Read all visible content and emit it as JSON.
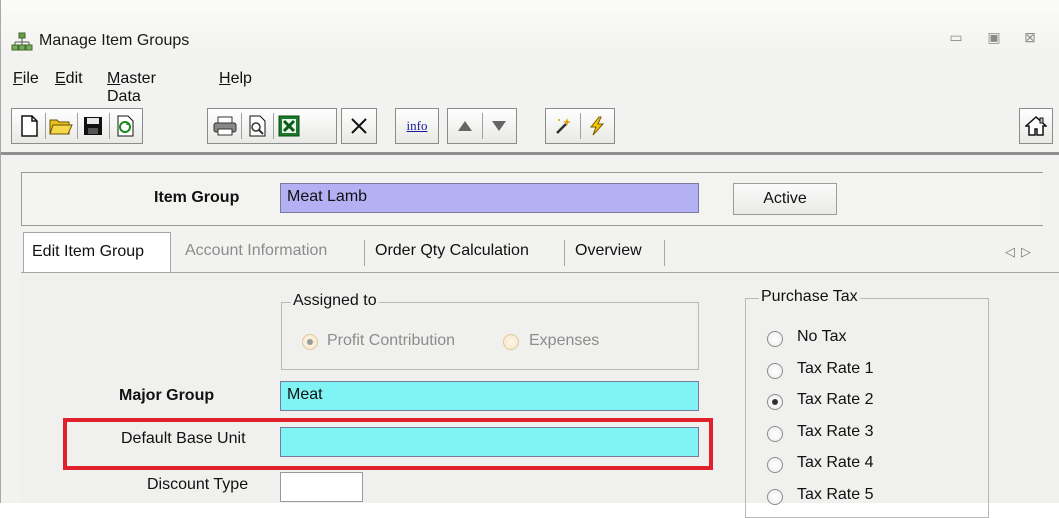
{
  "window": {
    "title": "Manage Item Groups"
  },
  "menu": [
    {
      "label": "File"
    },
    {
      "label": "Edit"
    },
    {
      "label": "Master Data"
    },
    {
      "label": "Help"
    }
  ],
  "toolbar": {
    "info_label": "info"
  },
  "header": {
    "item_group_label": "Item Group",
    "item_group_value": "Meat Lamb",
    "status_button": "Active"
  },
  "tabs": [
    {
      "label": "Edit Item Group",
      "selected": true
    },
    {
      "label": "Account Information",
      "disabled": true
    },
    {
      "label": "Order Qty Calculation"
    },
    {
      "label": "Overview"
    }
  ],
  "tab_scroll": {
    "left": "◁",
    "right": "▷"
  },
  "assigned_to": {
    "title": "Assigned to",
    "options": [
      "Profit Contribution",
      "Expenses"
    ],
    "selected": "Profit Contribution"
  },
  "form": {
    "major_group_label": "Major Group",
    "major_group_value": "Meat",
    "default_base_unit_label": "Default Base Unit",
    "default_base_unit_value": "",
    "discount_type_label": "Discount Type",
    "discount_type_value": ""
  },
  "purchase_tax": {
    "title": "Purchase Tax",
    "options": [
      "No Tax",
      "Tax Rate 1",
      "Tax Rate 2",
      "Tax Rate 3",
      "Tax Rate 4",
      "Tax Rate 5"
    ],
    "selected": "Tax Rate 2"
  },
  "colors": {
    "item_group_field": "#b4b0f4",
    "cyan_field": "#80f4f4",
    "highlight": "#e0202a"
  }
}
